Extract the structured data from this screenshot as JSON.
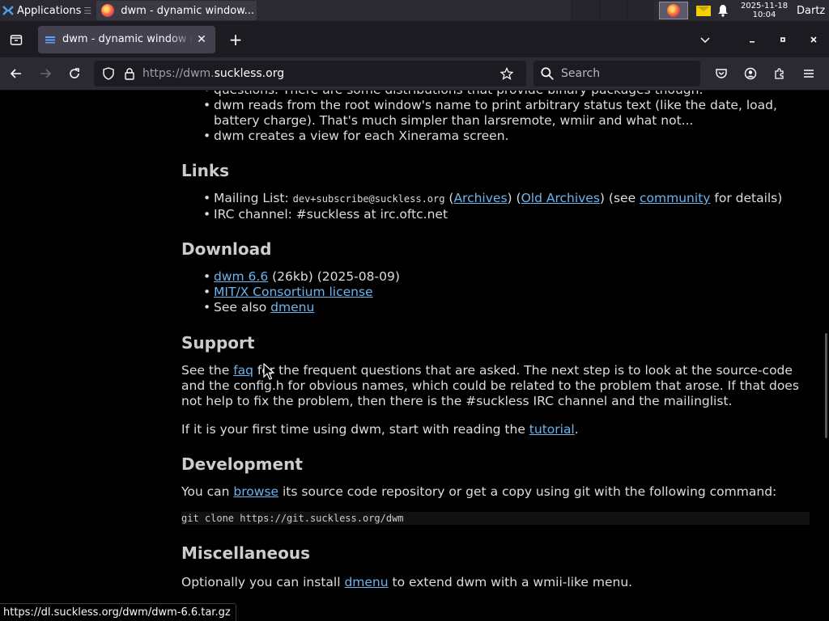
{
  "taskbar": {
    "apps_label": "Applications",
    "apps_suffix": "☰",
    "window_title": "dwm - dynamic window...",
    "clock_date": "2025-11-18",
    "clock_time": "10:04",
    "user": "Dartz"
  },
  "tabbar": {
    "tab_title": "dwm - dynamic window manager",
    "close_glyph": "✕",
    "newtab_glyph": "+"
  },
  "navbar": {
    "url_prefix": "https://dwm.",
    "url_domain": "suckless.org",
    "search_placeholder": "Search"
  },
  "content": {
    "features_tail": {
      "line0": "questions. There are some distributions that provide binary packages though.",
      "item1": "dwm reads from the root window's name to print arbitrary status text (like the date, load, battery charge). That's much simpler than larsremote, wmiir and what not...",
      "item2": "dwm creates a view for each Xinerama screen."
    },
    "links": {
      "heading": "Links",
      "mailing_label": "Mailing List: ",
      "mailing_address": "dev+subscribe@suckless.org",
      "archives": "Archives",
      "old_archives": "Old Archives",
      "see": "(see ",
      "community": "community",
      "for_details": " for details)",
      "irc": "IRC channel: #suckless at irc.oftc.net"
    },
    "download": {
      "heading": "Download",
      "dwm_link": "dwm 6.6",
      "dwm_meta": " (26kb) (2025-08-09)",
      "license_link": "MIT/X Consortium license",
      "see_also": "See also ",
      "dmenu_link": "dmenu"
    },
    "support": {
      "heading": "Support",
      "p1_a": "See the ",
      "faq_link": "faq",
      "p1_b": " for the frequent questions that are asked. The next step is to look at the source-code and the config.h for obvious names, which could be related to the problem that arose. If that does not help to fix the problem, then there is the #suckless IRC channel and the mailinglist.",
      "p2_a": "If it is your first time using dwm, start with reading the ",
      "tutorial_link": "tutorial",
      "p2_b": "."
    },
    "development": {
      "heading": "Development",
      "p_a": "You can ",
      "browse_link": "browse",
      "p_b": " its source code repository or get a copy using git with the following command:",
      "code": "git clone https://git.suckless.org/dwm"
    },
    "misc": {
      "heading": "Miscellaneous",
      "p_a": "Optionally you can install ",
      "dmenu_link": "dmenu",
      "p_b": " to extend dwm with a wmii-like menu."
    }
  },
  "status_url": "https://dl.suckless.org/dwm/dwm-6.6.tar.gz",
  "colors": {
    "link": "#6cb4ee",
    "background": "#000000",
    "chrome": "#2b2a33"
  }
}
